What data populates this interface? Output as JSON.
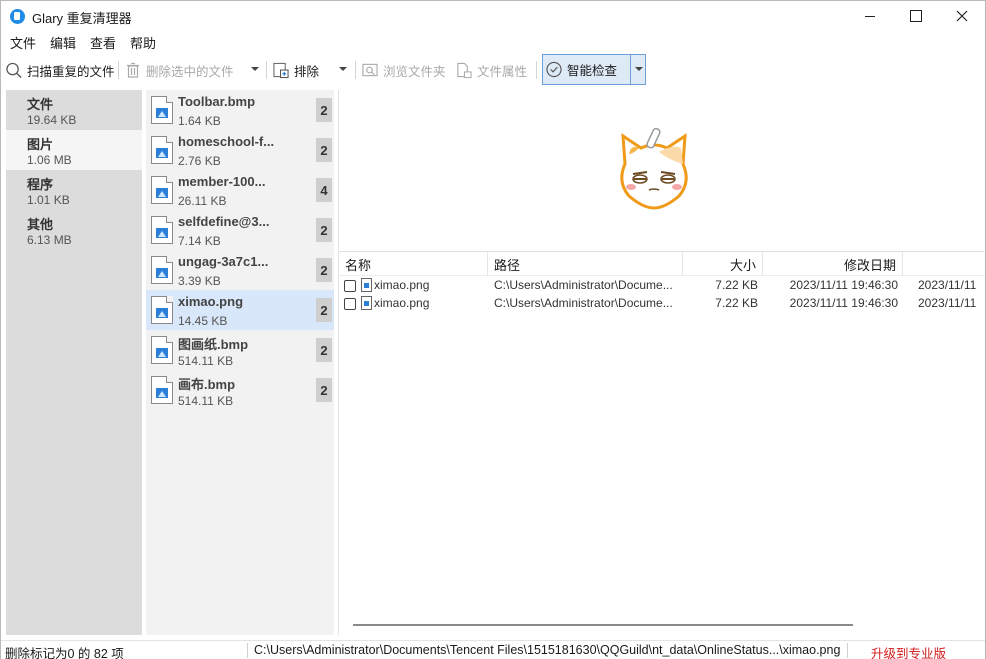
{
  "window": {
    "title": "Glary 重复清理器"
  },
  "menu": [
    "文件",
    "编辑",
    "查看",
    "帮助"
  ],
  "toolbar": {
    "scan_label": "扫描重复的文件",
    "delete_label": "删除选中的文件",
    "exclude_label": "排除",
    "browse_label": "浏览文件夹",
    "props_label": "文件属性",
    "smart_label": "智能检查"
  },
  "categories": [
    {
      "name": "文件",
      "size": "19.64 KB"
    },
    {
      "name": "图片",
      "size": "1.06 MB"
    },
    {
      "name": "程序",
      "size": "1.01 KB"
    },
    {
      "name": "其他",
      "size": "6.13 MB"
    }
  ],
  "groups": [
    {
      "name": "Toolbar.bmp",
      "size": "1.64 KB",
      "count": "2"
    },
    {
      "name": "homeschool-f...",
      "size": "2.76 KB",
      "count": "2"
    },
    {
      "name": "member-100...",
      "size": "26.11 KB",
      "count": "4"
    },
    {
      "name": "selfdefine@3...",
      "size": "7.14 KB",
      "count": "2"
    },
    {
      "name": "ungag-3a7c1...",
      "size": "3.39 KB",
      "count": "2"
    },
    {
      "name": "ximao.png",
      "size": "14.45 KB",
      "count": "2"
    },
    {
      "name": "图画纸.bmp",
      "size": "514.11 KB",
      "count": "2"
    },
    {
      "name": "画布.bmp",
      "size": "514.11 KB",
      "count": "2"
    }
  ],
  "table": {
    "headers": {
      "name": "名称",
      "path": "路径",
      "size": "大小",
      "modified": "修改日期"
    },
    "rows": [
      {
        "name": "ximao.png",
        "path": "C:\\Users\\Administrator\\Docume...",
        "size": "7.22 KB",
        "modified": "2023/11/11 19:46:30",
        "extra": "2023/11/11"
      },
      {
        "name": "ximao.png",
        "path": "C:\\Users\\Administrator\\Docume...",
        "size": "7.22 KB",
        "modified": "2023/11/11 19:46:30",
        "extra": "2023/11/11"
      }
    ]
  },
  "status": {
    "marked": "删除标记为0 的 82 项",
    "path": "C:\\Users\\Administrator\\Documents\\Tencent Files\\1515181630\\QQGuild\\nt_data\\OnlineStatus...\\ximao.png",
    "upgrade": "升级到专业版"
  },
  "icons": {
    "app": "glary-app-icon",
    "scan": "search-icon",
    "delete": "trash-icon",
    "exclude": "exclude-icon",
    "browse": "folder-search-icon",
    "props": "file-properties-icon",
    "smart": "check-circle-icon"
  },
  "colors": {
    "selected_group": "#d8e7fa",
    "upgrade_link": "#d11a1a",
    "accent": "#1f8ce6"
  }
}
